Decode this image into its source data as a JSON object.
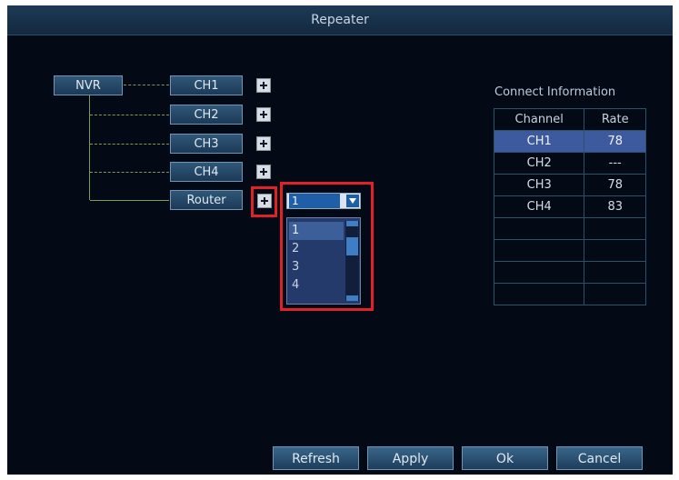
{
  "window": {
    "title": "Repeater"
  },
  "topology": {
    "root": "NVR",
    "channels": [
      "CH1",
      "CH2",
      "CH3",
      "CH4"
    ],
    "router": "Router"
  },
  "router_select": {
    "value": "1",
    "options": [
      "1",
      "2",
      "3",
      "4"
    ],
    "highlighted_option": "1"
  },
  "connect_info": {
    "title": "Connect Information",
    "columns": [
      "Channel",
      "Rate"
    ],
    "rows": [
      {
        "channel": "CH1",
        "rate": "78"
      },
      {
        "channel": "CH2",
        "rate": "---"
      },
      {
        "channel": "CH3",
        "rate": "78"
      },
      {
        "channel": "CH4",
        "rate": "83"
      },
      {
        "channel": "",
        "rate": ""
      },
      {
        "channel": "",
        "rate": ""
      },
      {
        "channel": "",
        "rate": ""
      },
      {
        "channel": "",
        "rate": ""
      }
    ],
    "highlighted_row": "CH1"
  },
  "buttons": {
    "refresh": "Refresh",
    "apply": "Apply",
    "ok": "Ok",
    "cancel": "Cancel"
  },
  "colors": {
    "highlight_red": "#e1202a",
    "selection_blue": "#3e5a9e",
    "background": "#030a16"
  }
}
